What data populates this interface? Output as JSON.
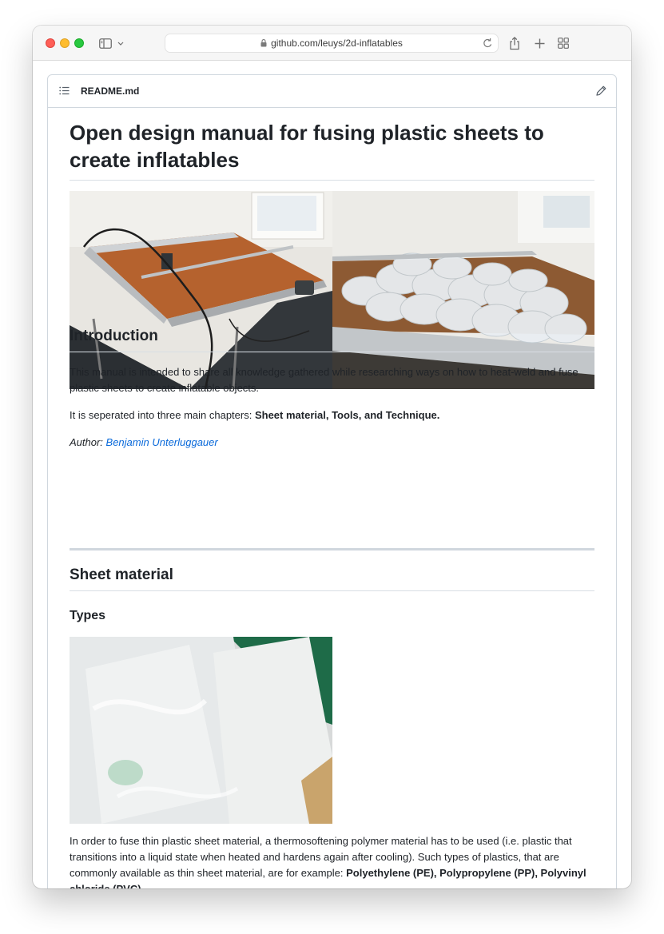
{
  "browser": {
    "url": "github.com/leuys/2d-inflatables"
  },
  "readme": {
    "filename": "README.md",
    "title": "Open design manual for fusing plastic sheets to create inflatables",
    "intro_heading": "Introduction",
    "intro_para": "This manual is intended to share all knowledge gathered while researching ways on how to heat-weld and fuse plastic sheets to create inflatable objects.",
    "chapters_prefix": "It is seperated into three main chapters: ",
    "chapters_bold": "Sheet material, Tools, and Technique.",
    "author_label": "Author: ",
    "author_name": "Benjamin Unterluggauer",
    "sheet_heading": "Sheet material",
    "types_heading": "Types",
    "types_para_1": "In order to fuse thin plastic sheet material, a thermosoftening polymer material has to be used (i.e. plastic that transitions into a liquid state when heated and hardens again after cooling). Such types of plastics, that are commonly available as thin sheet material, are for example: ",
    "types_para_bold": "Polyethylene (PE), Polypropylene (PP), Polyvinyl chloride (PVC)"
  },
  "icons": {
    "sidebar": "sidebar-icon",
    "chevron": "chevron-down-icon",
    "lock": "lock-icon",
    "reload": "reload-icon",
    "share": "share-icon",
    "new_tab": "plus-icon",
    "tab_overview": "tab-grid-icon",
    "toc": "list-icon",
    "edit": "pencil-icon"
  }
}
